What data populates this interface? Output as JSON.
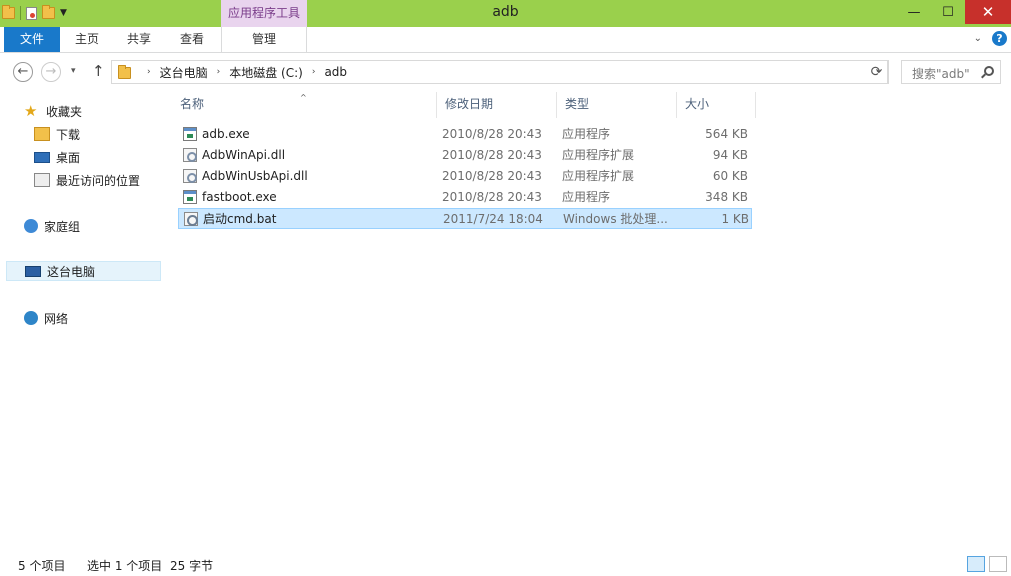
{
  "window": {
    "title": "adb",
    "contextual_tab_group": "应用程序工具",
    "controls": {
      "minimize": "—",
      "maximize": "☐",
      "close": "✕"
    }
  },
  "ribbon": {
    "tabs": [
      {
        "label": "文件"
      },
      {
        "label": "主页"
      },
      {
        "label": "共享"
      },
      {
        "label": "查看"
      },
      {
        "label": "管理"
      }
    ],
    "help_label": "?",
    "expand_chevron": "⌄"
  },
  "navigation": {
    "back": "←",
    "forward": "→",
    "recent_dropdown": "▾",
    "up": "↑"
  },
  "address_bar": {
    "crumbs": [
      "这台电脑",
      "本地磁盘 (C:)",
      "adb"
    ],
    "separator": "›",
    "dropdown": "⌄",
    "refresh": "⟳"
  },
  "search": {
    "placeholder": "搜索\"adb\""
  },
  "nav_pane": {
    "items": [
      {
        "label": "收藏夹",
        "icon": "star-icon"
      },
      {
        "label": "下载",
        "icon": "downloads-folder-icon"
      },
      {
        "label": "桌面",
        "icon": "desktop-icon"
      },
      {
        "label": "最近访问的位置",
        "icon": "recent-places-icon"
      },
      {
        "label": "家庭组",
        "icon": "homegroup-icon"
      },
      {
        "label": "这台电脑",
        "icon": "computer-icon",
        "selected": true
      },
      {
        "label": "网络",
        "icon": "network-icon"
      }
    ]
  },
  "columns": {
    "name": "名称",
    "date": "修改日期",
    "type": "类型",
    "size": "大小",
    "sort_indicator": "^"
  },
  "files": [
    {
      "name": "adb.exe",
      "date": "2010/8/28 20:43",
      "type": "应用程序",
      "size": "564 KB",
      "icon": "exe-icon"
    },
    {
      "name": "AdbWinApi.dll",
      "date": "2010/8/28 20:43",
      "type": "应用程序扩展",
      "size": "94 KB",
      "icon": "dll-icon"
    },
    {
      "name": "AdbWinUsbApi.dll",
      "date": "2010/8/28 20:43",
      "type": "应用程序扩展",
      "size": "60 KB",
      "icon": "dll-icon"
    },
    {
      "name": "fastboot.exe",
      "date": "2010/8/28 20:43",
      "type": "应用程序",
      "size": "348 KB",
      "icon": "exe-icon"
    },
    {
      "name": "启动cmd.bat",
      "date": "2011/7/24 18:04",
      "type": "Windows 批处理...",
      "size": "1 KB",
      "icon": "bat-icon",
      "selected": true
    }
  ],
  "status_bar": {
    "item_count": "5 个项目",
    "selection": "选中 1 个项目",
    "selection_size": "25 字节"
  },
  "colors": {
    "titlebar": "#9ad04c",
    "file_tab": "#1979ca",
    "selection": "#cce8ff",
    "contextual_tab": "#e9d4ee"
  }
}
